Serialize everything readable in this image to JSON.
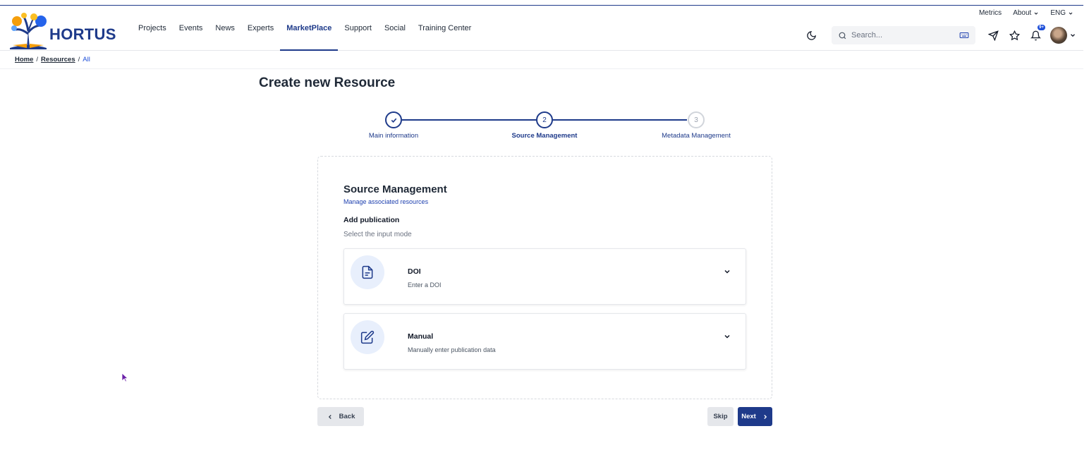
{
  "utility": {
    "metrics": "Metrics",
    "about": "About",
    "lang": "ENG"
  },
  "brand": {
    "name": "HORTUS"
  },
  "nav": {
    "items": [
      {
        "label": "Projects"
      },
      {
        "label": "Events"
      },
      {
        "label": "News"
      },
      {
        "label": "Experts"
      },
      {
        "label": "MarketPlace",
        "active": true
      },
      {
        "label": "Support"
      },
      {
        "label": "Social"
      },
      {
        "label": "Training Center"
      }
    ]
  },
  "search": {
    "placeholder": "Search..."
  },
  "notifications": {
    "badge": "9+"
  },
  "breadcrumb": {
    "home": "Home",
    "resources": "Resources",
    "current": "All"
  },
  "page": {
    "title": "Create new Resource"
  },
  "stepper": {
    "steps": [
      {
        "number": "",
        "label": "Main information",
        "state": "done"
      },
      {
        "number": "2",
        "label": "Source Management",
        "state": "current"
      },
      {
        "number": "3",
        "label": "Metadata Management",
        "state": "pending"
      }
    ]
  },
  "section": {
    "title": "Source Management",
    "subtitle": "Manage associated resources",
    "add_publication": "Add publication",
    "select_mode": "Select the input mode",
    "options": [
      {
        "title": "DOI",
        "desc": "Enter a DOI",
        "icon": "document-icon"
      },
      {
        "title": "Manual",
        "desc": "Manually enter publication data",
        "icon": "edit-icon"
      }
    ]
  },
  "buttons": {
    "back": "Back",
    "skip": "Skip",
    "next": "Next"
  },
  "colors": {
    "primary": "#1e3a8a",
    "accent_bg": "#e8effc"
  }
}
